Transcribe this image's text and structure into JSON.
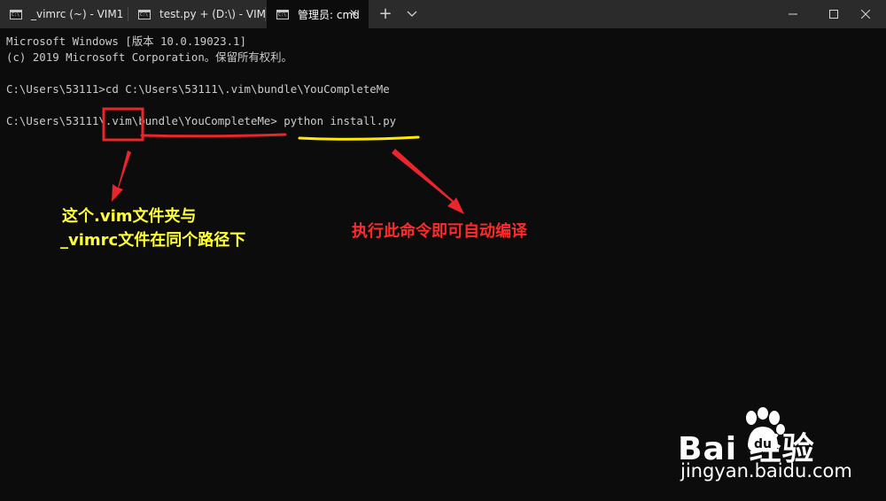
{
  "tabs": [
    {
      "label": "_vimrc (~) - VIM1",
      "active": false
    },
    {
      "label": "test.py + (D:\\) - VIM",
      "active": false
    },
    {
      "label": "管理员: cmd",
      "active": true
    }
  ],
  "window_controls": {
    "new_tab": "+",
    "dropdown": "⌵",
    "minimize": "minimize-icon",
    "maximize": "maximize-icon",
    "close": "close-icon"
  },
  "terminal": {
    "lines": [
      "Microsoft Windows [版本 10.0.19023.1]",
      "(c) 2019 Microsoft Corporation。保留所有权利。",
      "",
      "C:\\Users\\53111>cd C:\\Users\\53111\\.vim\\bundle\\YouCompleteMe",
      "",
      "C:\\Users\\53111\\.vim\\bundle\\YouCompleteMe> python install.py"
    ]
  },
  "annotations": {
    "left_note_line1": "这个.vim文件夹与",
    "left_note_line2": "_vimrc文件在同个路径下",
    "right_note": "执行此命令即可自动编译",
    "colors": {
      "left_note": "#ffff33",
      "right_note": "#ff2a2a",
      "red_mark": "#e8262b",
      "yellow_underline": "#ffeb00"
    }
  },
  "watermark": {
    "brand": "Bai  经验",
    "url": "jingyan.baidu.com"
  }
}
